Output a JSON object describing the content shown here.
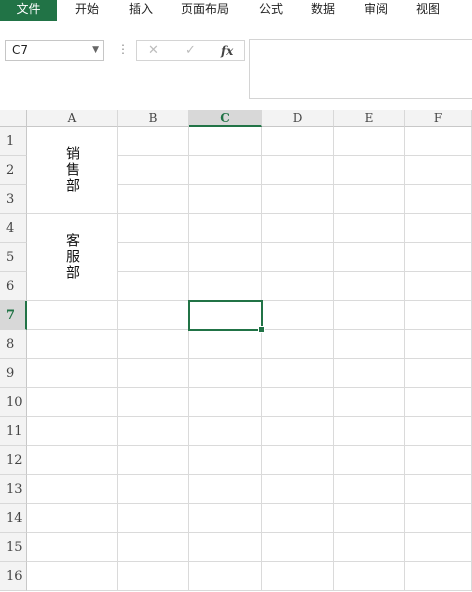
{
  "ribbon": {
    "tabs": [
      "文件",
      "开始",
      "插入",
      "页面布局",
      "公式",
      "数据",
      "审阅",
      "视图"
    ]
  },
  "formula_bar": {
    "name_box": "C7",
    "formula": ""
  },
  "sheet": {
    "columns": [
      "A",
      "B",
      "C",
      "D",
      "E",
      "F"
    ],
    "rows": [
      "1",
      "2",
      "3",
      "4",
      "5",
      "6",
      "7",
      "8",
      "9",
      "10",
      "11",
      "12",
      "13",
      "14",
      "15",
      "16"
    ],
    "active_cell": "C7",
    "merged": [
      {
        "range": "A1:A3",
        "text": "销售部"
      },
      {
        "range": "A4:A6",
        "text": "客服部"
      }
    ]
  }
}
